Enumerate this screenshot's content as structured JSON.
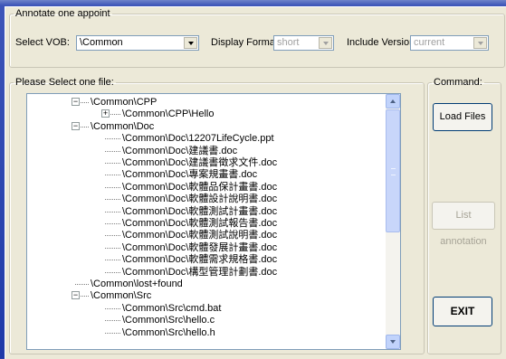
{
  "top_group": {
    "legend": "Annotate one appoint",
    "vob_label": "Select VOB:",
    "vob_value": "\\Common",
    "format_label": "Display Format:",
    "format_value": "short",
    "version_label": "Include Version:",
    "version_value": "current"
  },
  "file_group": {
    "legend": "Please Select one file:"
  },
  "command_group": {
    "legend": "Command:",
    "load_label": "Load Files",
    "list_label": "List annotation",
    "exit_label": "EXIT"
  },
  "tree": {
    "nodes": [
      {
        "label": "\\Common\\CPP",
        "level": 0,
        "expander": "minus"
      },
      {
        "label": "\\Common\\CPP\\Hello",
        "level": 1,
        "expander": "plus"
      },
      {
        "label": "\\Common\\Doc",
        "level": 0,
        "expander": "minus"
      },
      {
        "label": "\\Common\\Doc\\12207LifeCycle.ppt",
        "level": 1,
        "expander": "none"
      },
      {
        "label": "\\Common\\Doc\\建議書.doc",
        "level": 1,
        "expander": "none"
      },
      {
        "label": "\\Common\\Doc\\建議書徵求文件.doc",
        "level": 1,
        "expander": "none"
      },
      {
        "label": "\\Common\\Doc\\專案規畫書.doc",
        "level": 1,
        "expander": "none"
      },
      {
        "label": "\\Common\\Doc\\軟體品保計畫書.doc",
        "level": 1,
        "expander": "none"
      },
      {
        "label": "\\Common\\Doc\\軟體設計說明書.doc",
        "level": 1,
        "expander": "none"
      },
      {
        "label": "\\Common\\Doc\\軟體測試計畫書.doc",
        "level": 1,
        "expander": "none"
      },
      {
        "label": "\\Common\\Doc\\軟體測試報告書.doc",
        "level": 1,
        "expander": "none"
      },
      {
        "label": "\\Common\\Doc\\軟體測試說明書.doc",
        "level": 1,
        "expander": "none"
      },
      {
        "label": "\\Common\\Doc\\軟體發展計畫書.doc",
        "level": 1,
        "expander": "none"
      },
      {
        "label": "\\Common\\Doc\\軟體需求規格書.doc",
        "level": 1,
        "expander": "none"
      },
      {
        "label": "\\Common\\Doc\\構型管理計劃書.doc",
        "level": 1,
        "expander": "none"
      },
      {
        "label": "\\Common\\lost+found",
        "level": 0,
        "expander": "none"
      },
      {
        "label": "\\Common\\Src",
        "level": 0,
        "expander": "minus"
      },
      {
        "label": "\\Common\\Src\\cmd.bat",
        "level": 1,
        "expander": "none"
      },
      {
        "label": "\\Common\\Src\\hello.c",
        "level": 1,
        "expander": "none"
      },
      {
        "label": "\\Common\\Src\\hello.h",
        "level": 1,
        "expander": "none"
      }
    ]
  },
  "icons": {
    "expand": "plus-box-icon",
    "collapse": "minus-box-icon",
    "dropdown": "chevron-down-icon",
    "scroll_up": "scroll-up-arrow-icon",
    "scroll_down": "scroll-down-arrow-icon"
  },
  "colors": {
    "window_bg": "#ece9d8",
    "desktop_bg": "#2c3fa8",
    "control_border": "#7f9db9",
    "scrollbar": "#c1d3fb"
  }
}
